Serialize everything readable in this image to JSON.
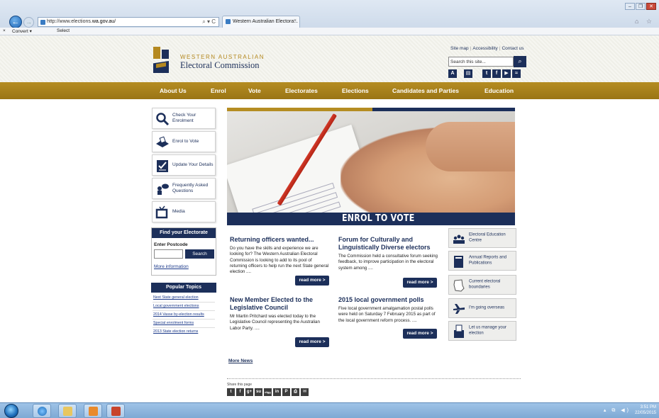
{
  "browser": {
    "url_prefix": "http://www.elections.",
    "url_domain": "wa.gov.au",
    "url_suffix": "/",
    "address_icons": "⌕ ▾ C",
    "tab_title": "Western Australian Electora...",
    "tab_close": "×",
    "window_controls": {
      "minimize": "–",
      "restore": "❐",
      "close": "✕"
    },
    "right_icons": "⌂ ☆",
    "cmd_bar": {
      "close": "×",
      "convert": "Convert ▾",
      "select": "Select"
    }
  },
  "header": {
    "logo_line1": "WESTERN AUSTRALIAN",
    "logo_line2": "Electoral Commission",
    "util_links": [
      "Site map",
      "Accessibility",
      "Contact us"
    ],
    "search_placeholder": "Search this site...",
    "search_button_icon": "search-icon",
    "share_icons": [
      "A",
      "▤",
      "t",
      "f",
      "▶",
      "≈"
    ]
  },
  "nav": [
    "About Us",
    "Enrol",
    "Vote",
    "Electorates",
    "Elections",
    "Candidates and Parties",
    "Education"
  ],
  "sidebar": {
    "cards": [
      {
        "label": "Check Your Enrolment",
        "icon": "magnifier-icon"
      },
      {
        "label": "Enrol to Vote",
        "icon": "ballot-box-icon"
      },
      {
        "label": "Update Your Details",
        "icon": "checklist-icon"
      },
      {
        "label": "Frequently Asked Questions",
        "icon": "people-chat-icon"
      },
      {
        "label": "Media",
        "icon": "tv-icon"
      }
    ],
    "find": {
      "title": "Find your Electorate",
      "label": "Enter Postcode",
      "button": "Search",
      "more": "More information"
    },
    "popular": {
      "title": "Popular Topics",
      "links": [
        "Next State general election",
        "Local government elections",
        "2014 Vasse by-election results",
        "Special enrolment forms",
        "2013 State election returns"
      ]
    }
  },
  "hero": {
    "title": "ENROL TO VOTE"
  },
  "news": [
    {
      "title": "Returning officers wanted...",
      "body": "Do you have the skills and experience we are looking for? The Western Australian Electoral Commission is looking to add to its pool of returning officers to help run the next State general election ....",
      "read_more": "read more >"
    },
    {
      "title": "Forum for Culturally and Linguistically Diverse electors",
      "body": "The Commission held a consultative forum seeking feedback, to improve participation in the electoral system among ....",
      "read_more": "read more >"
    },
    {
      "title": "New Member Elected to the Legislative Council",
      "body": "Mr Martin Pritchard was elected today to the Legislative Council representing the Australian Labor Party. ....",
      "read_more": "read more >"
    },
    {
      "title": "2015 local government polls",
      "body": "Five local government amalgamation postal polls were held on Saturday 7 February 2015 as part of the local government reform process. ....",
      "read_more": "read more >"
    }
  ],
  "more_news": "More News",
  "share": {
    "label": "Share this page",
    "icons": [
      "t",
      "f",
      "g+",
      "su",
      "digg",
      "in",
      "P",
      "⎙",
      "✉"
    ]
  },
  "right_cards": [
    {
      "label": "Electoral Education Centre",
      "icon": "group-icon"
    },
    {
      "label": "Annual Reports and Publications",
      "icon": "book-icon"
    },
    {
      "label": "Current electoral boundaries",
      "icon": "map-icon"
    },
    {
      "label": "I'm going overseas",
      "icon": "plane-icon"
    },
    {
      "label": "Let us manage your election",
      "icon": "ballot-icon"
    }
  ],
  "taskbar": {
    "time": "3:51 PM",
    "date": "22/05/2015",
    "tray_icons": "▴ ⧉ ◀)"
  },
  "colors": {
    "navy": "#1c2f5a",
    "gold": "#b58d22"
  }
}
